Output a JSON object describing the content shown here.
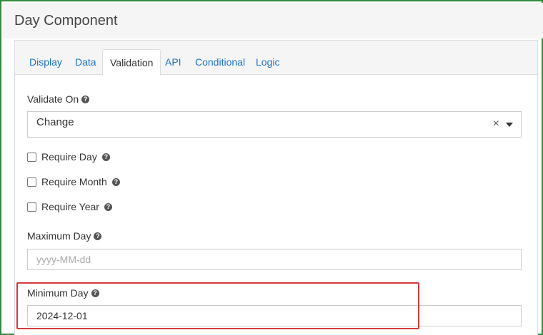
{
  "title": "Day Component",
  "tabs": [
    {
      "label": "Display"
    },
    {
      "label": "Data"
    },
    {
      "label": "Validation"
    },
    {
      "label": "API"
    },
    {
      "label": "Conditional"
    },
    {
      "label": "Logic"
    }
  ],
  "active_tab": "Validation",
  "validate_on": {
    "label": "Validate On",
    "value": "Change",
    "clear": "×"
  },
  "checks": {
    "require_day": "Require Day",
    "require_month": "Require Month",
    "require_year": "Require Year"
  },
  "maximum_day": {
    "label": "Maximum Day",
    "value": "",
    "placeholder": "yyyy-MM-dd"
  },
  "minimum_day": {
    "label": "Minimum Day",
    "value": "2024-12-01"
  },
  "help_glyph": "?",
  "colors": {
    "accent": "#1a73c8",
    "frame": "#2e8b3d",
    "highlight": "#d43a3a"
  }
}
